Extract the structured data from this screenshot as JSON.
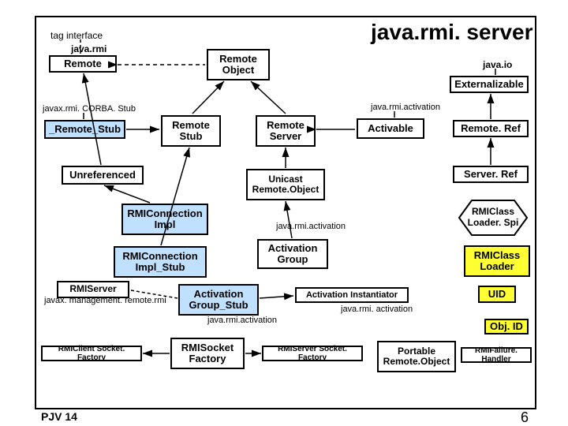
{
  "title": "java.rmi. server",
  "labels": {
    "tagInterface": "tag interface",
    "pkgJavaRmi": "java.rmi",
    "pkgJavaIo": "java.io",
    "pkgCorbaStub": "javax.rmi. CORBA. Stub",
    "pkgActivation1": "java.rmi.activation",
    "pkgActivation2": "java.rmi.activation",
    "pkgActivation3": "java.rmi. activation",
    "pkgActivation4": "java.rmi.activation",
    "pkgMgmtRmi": "javax. management. remote.rmi"
  },
  "boxes": {
    "remote": "Remote",
    "remoteObject": "Remote Object",
    "externalizable": "Externalizable",
    "remoteStub": "Remote Stub",
    "remoteServer": "Remote Server",
    "activable": "Activable",
    "remoteRef": "Remote. Ref",
    "remoteStubU": "_Remote_Stub",
    "unreferenced": "Unreferenced",
    "serverRef": "Server. Ref",
    "unicastRemoteObject": "Unicast Remote.Object",
    "rmiClassLoaderSpi": "RMIClass Loader. Spi",
    "rmiConnectionImpl": "RMIConnection Impl",
    "activationGroup": "Activation Group",
    "rmiClassLoader": "RMIClass Loader",
    "rmiConnectionImplStub": "RMIConnection Impl_Stub",
    "rmiServer": "RMIServer",
    "activationGroupStub": "Activation Group_Stub",
    "activationInstantiator": "Activation Instantiator",
    "uid": "UID",
    "objId": "Obj. ID",
    "rmiClientSocketFactory": "RMIClient Socket. Factory",
    "rmiSocketFactory": "RMISocket Factory",
    "rmiServerSocketFactory": "RMIServer Socket. Factory",
    "portableRemoteObject": "Portable Remote.Object",
    "rmiFailureHandler": "RMIFailure. Handler"
  },
  "footer": {
    "left": "PJV 14",
    "right": "6"
  }
}
